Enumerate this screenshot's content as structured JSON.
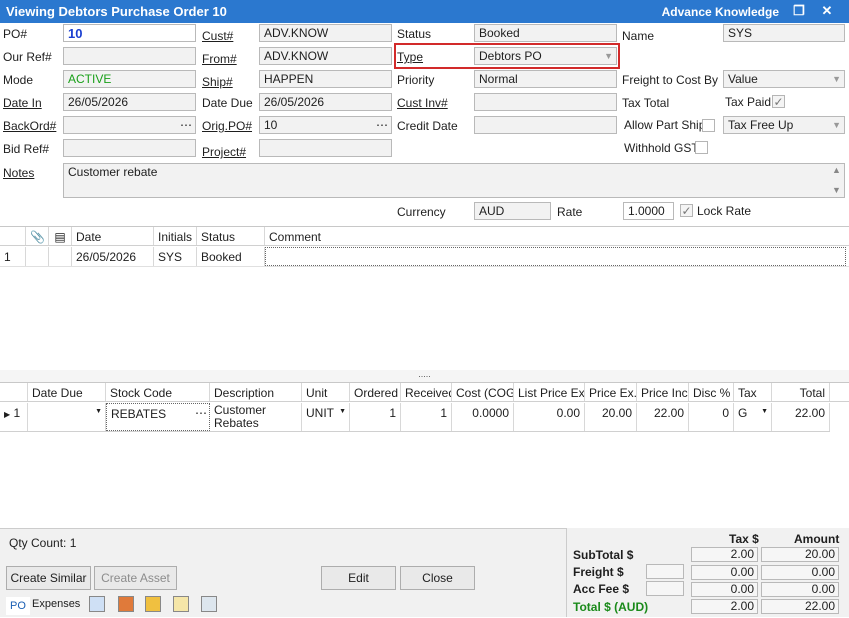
{
  "window": {
    "title": "Viewing Debtors Purchase Order 10",
    "company": "Advance Knowledge"
  },
  "header": {
    "po_label": "PO#",
    "po_value": "10",
    "our_ref_label": "Our Ref#",
    "our_ref_value": "",
    "mode_label": "Mode",
    "mode_value": "ACTIVE",
    "date_in_label": "Date In",
    "date_in_value": "26/05/2026",
    "backord_label": "BackOrd#",
    "backord_value": "",
    "bid_ref_label": "Bid Ref#",
    "bid_ref_value": "",
    "cust_label": "Cust#",
    "cust_value": "ADV.KNOW",
    "from_label": "From#",
    "from_value": "ADV.KNOW",
    "ship_label": "Ship#",
    "ship_value": "HAPPEN",
    "date_due_label": "Date Due",
    "date_due_value": "26/05/2026",
    "orig_po_label": "Orig.PO#",
    "orig_po_value": "10",
    "project_label": "Project#",
    "project_value": "",
    "status_label": "Status",
    "status_value": "Booked",
    "type_label": "Type",
    "type_value": "Debtors PO",
    "priority_label": "Priority",
    "priority_value": "Normal",
    "cust_inv_label": "Cust Inv#",
    "cust_inv_value": "",
    "credit_date_label": "Credit Date",
    "credit_date_value": "",
    "name_label": "Name",
    "name_value": "SYS",
    "freight_label": "Freight to Cost By",
    "freight_value": "Value",
    "tax_total_label": "Tax Total",
    "tax_paid_label": "Tax Paid",
    "allow_part_label": "Allow Part Ship",
    "tax_free_value": "Tax Free Up",
    "withhold_label": "Withhold GST",
    "notes_label": "Notes",
    "notes_value": "Customer rebate",
    "currency_label": "Currency",
    "currency_value": "AUD",
    "rate_label": "Rate",
    "rate_value": "1.0000",
    "lock_rate_label": "Lock Rate"
  },
  "history": {
    "columns": [
      "Date",
      "Initials",
      "Status",
      "Comment"
    ],
    "rows": [
      {
        "num": "1",
        "date": "26/05/2026",
        "initials": "SYS",
        "status": "Booked",
        "comment": ""
      }
    ]
  },
  "splitter": ".....",
  "lines": {
    "columns": [
      "Date Due",
      "Stock Code",
      "Description",
      "Unit",
      "Ordered",
      "Received",
      "Cost (COG)",
      "List Price Ex.",
      "Price Ex.",
      "Price Inc.",
      "Disc %",
      "Tax",
      "Total"
    ],
    "rows": [
      {
        "num": "1",
        "date_due": "",
        "stock_code": "REBATES",
        "description": "Customer Rebates",
        "unit": "UNIT",
        "ordered": "1",
        "received": "1",
        "cost": "0.0000",
        "list_price": "0.00",
        "price_ex": "20.00",
        "price_inc": "22.00",
        "disc": "0",
        "tax": "G",
        "total": "22.00"
      }
    ]
  },
  "footer": {
    "qty_count": "Qty Count: 1",
    "create_similar": "Create Similar",
    "create_asset": "Create Asset",
    "edit": "Edit",
    "close": "Close",
    "tabs": [
      "PO",
      "Expenses"
    ]
  },
  "totals": {
    "tax_header": "Tax $",
    "amount_header": "Amount",
    "subtotal_label": "SubTotal $",
    "subtotal_tax": "2.00",
    "subtotal_amount": "20.00",
    "freight_label": "Freight $",
    "freight_tax": "0.00",
    "freight_amount": "0.00",
    "accfee_label": "Acc Fee $",
    "accfee_tax": "0.00",
    "accfee_amount": "0.00",
    "total_label": "Total $ (AUD)",
    "total_tax": "2.00",
    "total_amount": "22.00"
  },
  "colors": {
    "title_bar": "#2b78cf",
    "po_number": "#1a3fd1",
    "active": "#1aa01a",
    "total_label": "#1a8a1a",
    "highlight": "#d22a2a"
  }
}
